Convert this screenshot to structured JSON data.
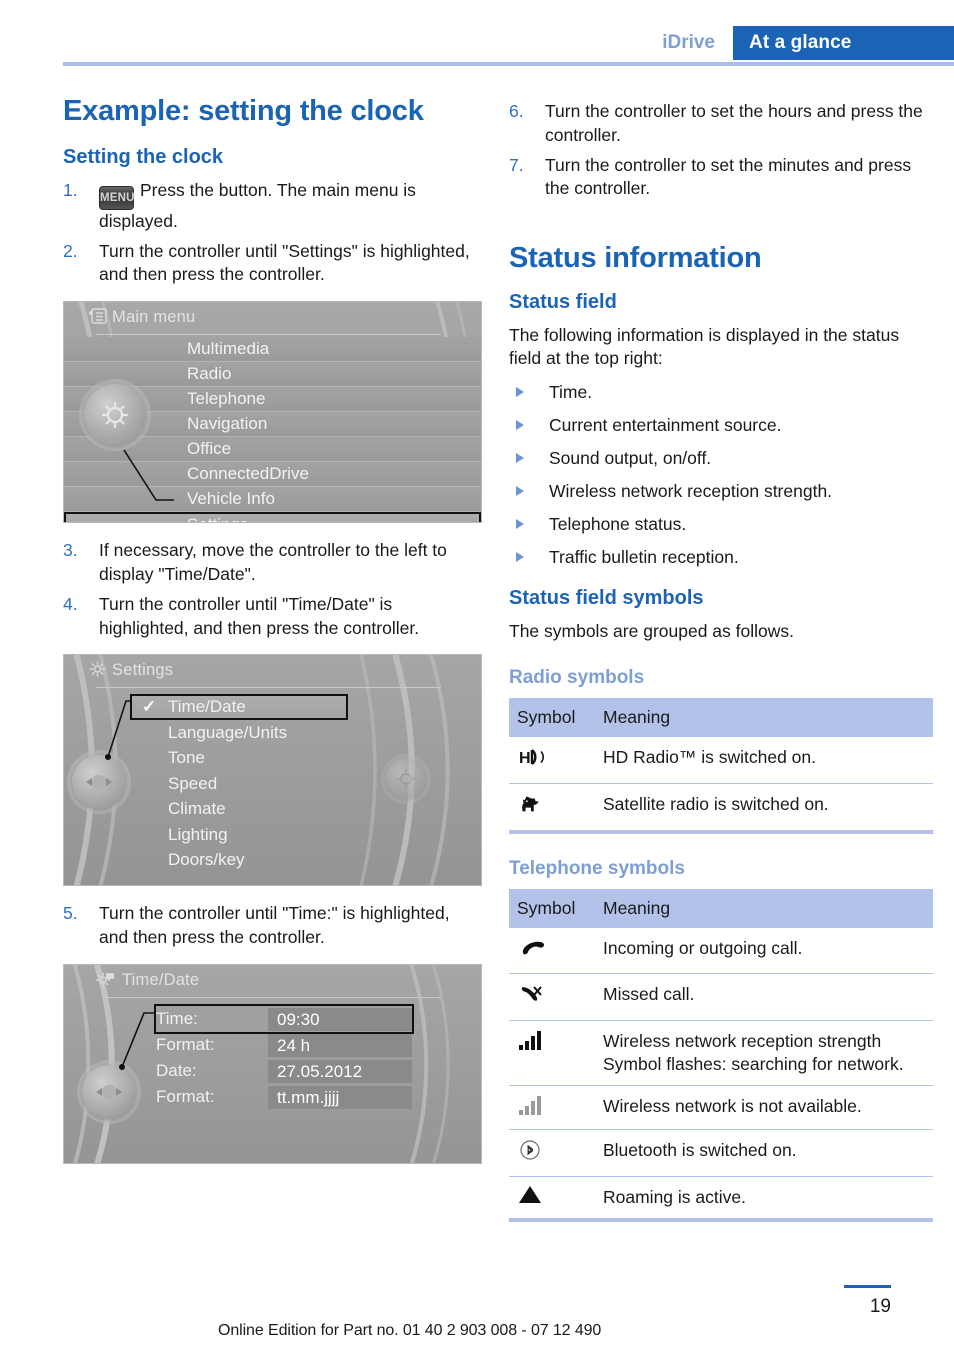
{
  "header": {
    "section_label": "iDrive",
    "tab_label": "At a glance"
  },
  "left_column": {
    "chapter_title": "Example: setting the clock",
    "section_title": "Setting the clock",
    "steps": [
      {
        "num": "1.",
        "menu_button": "MENU",
        "text": "Press the button. The main menu is displayed."
      },
      {
        "num": "2.",
        "text": "Turn the controller until \"Settings\" is highlighted, and then press the controller."
      },
      {
        "num": "3.",
        "text": "If necessary, move the controller to the left to display \"Time/Date\"."
      },
      {
        "num": "4.",
        "text": "Turn the controller until \"Time/Date\" is highlighted, and then press the controller."
      },
      {
        "num": "5.",
        "text": "Turn the controller until \"Time:\" is highlighted, and then press the controller."
      }
    ],
    "screen_main_menu": {
      "title": "Main menu",
      "icon": "list-menu-icon",
      "items": [
        "Multimedia",
        "Radio",
        "Telephone",
        "Navigation",
        "Office",
        "ConnectedDrive",
        "Vehicle Info",
        "Settings"
      ],
      "selected": "Settings"
    },
    "screen_settings": {
      "title": "Settings",
      "icon": "gear-icon",
      "items": [
        "Time/Date",
        "Language/Units",
        "Tone",
        "Speed",
        "Climate",
        "Lighting",
        "Doors/key"
      ],
      "selected": "Time/Date",
      "check_mark": "✓"
    },
    "screen_time_date": {
      "title": "Time/Date",
      "icon": "gear-clock-icon",
      "rows": [
        {
          "label": "Time:",
          "value": "09:30",
          "selected": true
        },
        {
          "label": "Format:",
          "value": "24 h",
          "selected": false
        },
        {
          "label": "Date:",
          "value": "27.05.2012",
          "selected": false
        },
        {
          "label": "Format:",
          "value": "tt.mm.jjjj",
          "selected": false
        }
      ]
    }
  },
  "right_column": {
    "steps": [
      {
        "num": "6.",
        "text": "Turn the controller to set the hours and press the controller."
      },
      {
        "num": "7.",
        "text": "Turn the controller to set the minutes and press the controller."
      }
    ],
    "chapter_title": "Status information",
    "status_field_heading": "Status field",
    "status_field_intro": "The following information is displayed in the status field at the top right:",
    "status_bullets": [
      "Time.",
      "Current entertainment source.",
      "Sound output, on/off.",
      "Wireless network reception strength.",
      "Telephone status.",
      "Traffic bulletin reception."
    ],
    "symbols_heading": "Status field symbols",
    "symbols_intro": "The symbols are grouped as follows.",
    "radio_symbols": {
      "heading": "Radio symbols",
      "columns": [
        "Symbol",
        "Meaning"
      ],
      "rows": [
        {
          "icon": "hd-radio-icon",
          "meaning": "HD Radio™ is switched on."
        },
        {
          "icon": "satellite-radio-dog-icon",
          "meaning": "Satellite radio is switched on."
        }
      ]
    },
    "telephone_symbols": {
      "heading": "Telephone symbols",
      "columns": [
        "Symbol",
        "Meaning"
      ],
      "rows": [
        {
          "icon": "phone-handset-icon",
          "meaning": "Incoming or outgoing call."
        },
        {
          "icon": "missed-call-icon",
          "meaning": "Missed call."
        },
        {
          "icon": "signal-bars-full-icon",
          "meaning": "Wireless network reception strength Symbol flashes: searching for network."
        },
        {
          "icon": "signal-bars-unavailable-icon",
          "meaning": "Wireless network is not available."
        },
        {
          "icon": "bluetooth-icon",
          "meaning": "Bluetooth is switched on."
        },
        {
          "icon": "roaming-triangle-icon",
          "meaning": "Roaming is active."
        }
      ]
    }
  },
  "footer": {
    "edition_text": "Online Edition for Part no. 01 40 2 903 008 - 07 12 490",
    "page_number": "19"
  },
  "colors": {
    "accent_blue": "#1b63b4",
    "light_blue": "#7e9fd4",
    "table_header": "#b3c2e8",
    "rule": "#a9bce4"
  }
}
